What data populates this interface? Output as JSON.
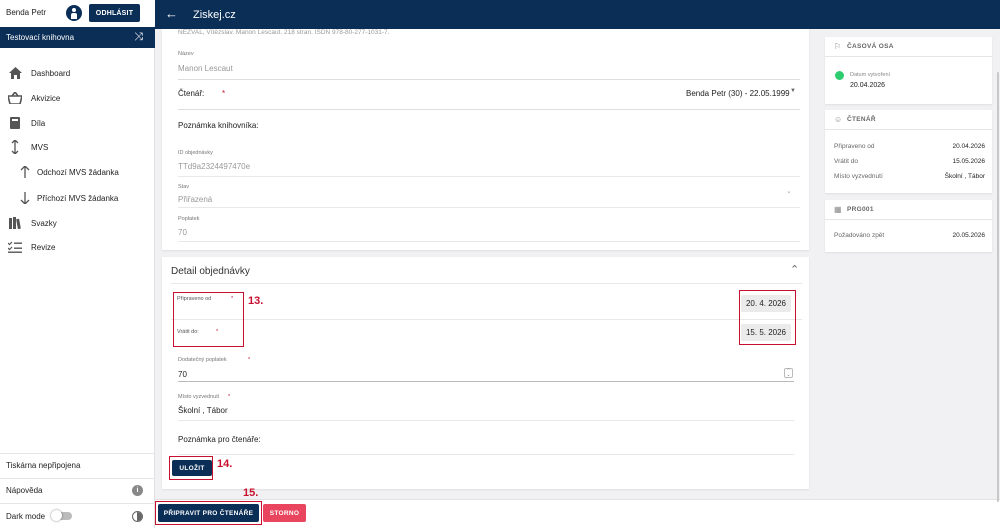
{
  "user": {
    "name": "Benda Petr",
    "logout_label": "ODHLÁSIT"
  },
  "library": {
    "name": "Testovací knihovna"
  },
  "nav": {
    "dashboard": "Dashboard",
    "acquisitions": "Akvizice",
    "works": "Díla",
    "mvs": "MVS",
    "outgoing": "Odchozí MVS žádanka",
    "incoming": "Příchozí MVS žádanka",
    "volumes": "Svazky",
    "revisions": "Revize"
  },
  "sidebar_bottom": {
    "printer": "Tiskárna nepřipojena",
    "help": "Nápověda",
    "dark_mode": "Dark mode"
  },
  "header": {
    "title": "Ziskej.cz"
  },
  "top_card": {
    "truncated_record": "NEZVAL, Vítězslav. Manon Lescaut. 218 stran. ISDN 978-80-277-1031-7.",
    "name_label": "Název",
    "name_value": "Manon Lescaut",
    "reader_label": "Čtenář:",
    "reader_required": "*",
    "reader_value": "Benda Petr (30) - 22.05.1999",
    "librarian_note_label": "Poznámka knihovníka:",
    "order_id_label": "ID objednávky",
    "order_id_value": "TTd9a2324497470e",
    "state_label": "Stav",
    "state_value": "Přiřazená",
    "fee_label": "Poplatek",
    "fee_value": "70"
  },
  "detail_card": {
    "title": "Detail objednávky",
    "prepared_from_label": "Připraveno od",
    "prepared_from_value": "20. 4. 2026",
    "return_by_label": "Vrátit do:",
    "return_by_value": "15. 5. 2026",
    "required_mark": "*",
    "extra_fee_label": "Dodatečný poplatek",
    "extra_fee_value": "70",
    "pickup_label": "Místo vyzvednutí",
    "pickup_value": "Školní , Tábor",
    "reader_note_label": "Poznámka pro čtenáře:",
    "save_label": "ULOŽIT"
  },
  "annotations": {
    "n13": "13.",
    "n14": "14.",
    "n15": "15."
  },
  "footer": {
    "prepare_label": "PŘIPRAVIT PRO ČTENÁŘE",
    "cancel_label": "STORNO"
  },
  "timeline": {
    "title": "ČASOVÁ OSA",
    "event_label": "Datum vytvoření",
    "event_date": "20.04.2026"
  },
  "reader_panel": {
    "title": "ČTENÁŘ",
    "rows": [
      {
        "k": "Připraveno od",
        "v": "20.04.2026"
      },
      {
        "k": "Vrátit do",
        "v": "15.05.2026"
      },
      {
        "k": "Místo vyzvednutí",
        "v": "Školní , Tábor"
      }
    ]
  },
  "prg_panel": {
    "title": "PRG001",
    "row": {
      "k": "Požadováno zpět",
      "v": "20.05.2026"
    }
  },
  "colors": {
    "primary": "#0b2e57",
    "danger": "#e9455e",
    "annotation": "#c8102e",
    "success": "#2ecc71"
  }
}
